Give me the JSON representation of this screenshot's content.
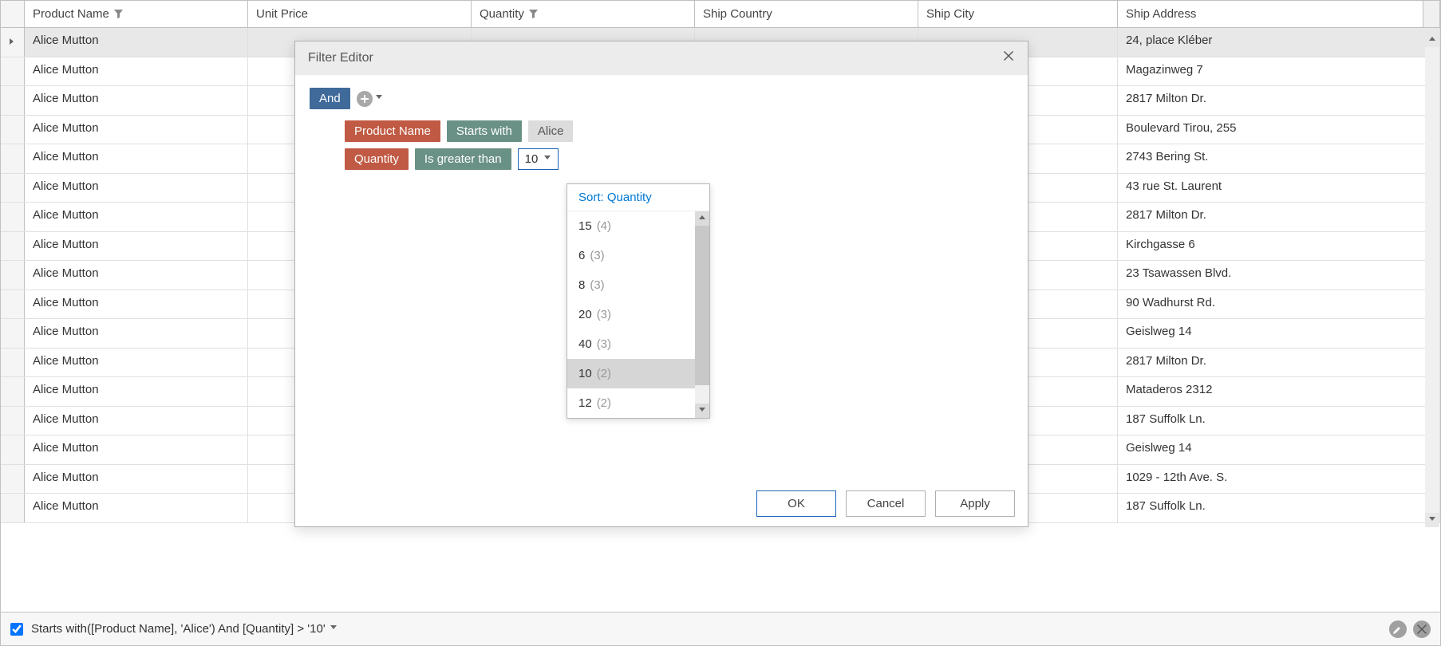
{
  "columns": {
    "product": "Product Name",
    "price": "Unit Price",
    "qty": "Quantity",
    "country": "Ship Country",
    "city": "Ship City",
    "addr": "Ship Address"
  },
  "rows": [
    {
      "product": "Alice Mutton",
      "addr": "24, place Kléber",
      "selected": true
    },
    {
      "product": "Alice Mutton",
      "addr": "Magazinweg 7"
    },
    {
      "product": "Alice Mutton",
      "addr": "2817 Milton Dr."
    },
    {
      "product": "Alice Mutton",
      "addr": "Boulevard Tirou, 255"
    },
    {
      "product": "Alice Mutton",
      "addr": "2743 Bering St."
    },
    {
      "product": "Alice Mutton",
      "addr": "43 rue St. Laurent"
    },
    {
      "product": "Alice Mutton",
      "addr": "2817 Milton Dr."
    },
    {
      "product": "Alice Mutton",
      "addr": "Kirchgasse 6"
    },
    {
      "product": "Alice Mutton",
      "addr": "23 Tsawassen Blvd."
    },
    {
      "product": "Alice Mutton",
      "addr": "90 Wadhurst Rd."
    },
    {
      "product": "Alice Mutton",
      "addr": "Geislweg 14"
    },
    {
      "product": "Alice Mutton",
      "addr": "2817 Milton Dr."
    },
    {
      "product": "Alice Mutton",
      "addr": "Mataderos  2312"
    },
    {
      "product": "Alice Mutton",
      "addr": "187 Suffolk Ln."
    },
    {
      "product": "Alice Mutton",
      "addr": "Geislweg 14"
    },
    {
      "product": "Alice Mutton",
      "addr": "1029 - 12th Ave. S."
    },
    {
      "product": "Alice Mutton",
      "addr": "187 Suffolk Ln."
    }
  ],
  "dialog": {
    "title": "Filter Editor",
    "root_op": "And",
    "conditions": [
      {
        "field": "Product Name",
        "op": "Starts with",
        "value": "Alice"
      },
      {
        "field": "Quantity",
        "op": "Is greater than",
        "value": "10"
      }
    ],
    "buttons": {
      "ok": "OK",
      "cancel": "Cancel",
      "apply": "Apply"
    }
  },
  "dropdown": {
    "header": "Sort: Quantity",
    "items": [
      {
        "v": "15",
        "c": "(4)"
      },
      {
        "v": "6",
        "c": "(3)"
      },
      {
        "v": "8",
        "c": "(3)"
      },
      {
        "v": "20",
        "c": "(3)"
      },
      {
        "v": "40",
        "c": "(3)"
      },
      {
        "v": "10",
        "c": "(2)",
        "hl": true
      },
      {
        "v": "12",
        "c": "(2)"
      }
    ]
  },
  "filter_panel": {
    "checked": true,
    "expr": "Starts with([Product Name], 'Alice') And [Quantity] > '10'"
  }
}
